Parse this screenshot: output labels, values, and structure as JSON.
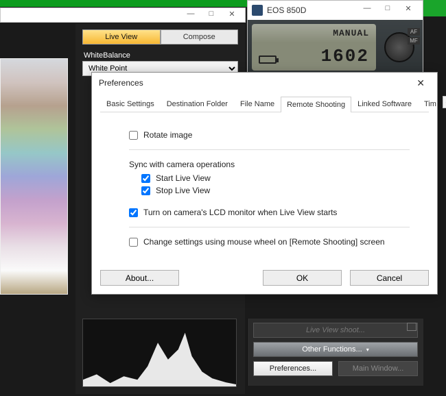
{
  "mainwin": {
    "controls": {
      "min": "—",
      "max": "□",
      "close": "✕"
    }
  },
  "rightstrip": {
    "tab_live": "Live View",
    "tab_compose": "Compose",
    "wb_label": "WhiteBalance",
    "wb_value": "White Point"
  },
  "eos": {
    "title": "EOS 850D",
    "mode": "MANUAL",
    "shots": "1602",
    "af": "AF",
    "mf": "MF"
  },
  "rpanel": {
    "liveview": "Live View shoot...",
    "other": "Other Functions...",
    "prefs": "Preferences...",
    "mainwin": "Main Window..."
  },
  "dlg": {
    "title": "Preferences",
    "tabs": {
      "basic": "Basic Settings",
      "dest": "Destination Folder",
      "file": "File Name",
      "remote": "Remote Shooting",
      "linked": "Linked Software",
      "tim": "Tim"
    },
    "rotate": "Rotate image",
    "sync_h": "Sync with camera operations",
    "start_lv": "Start Live View",
    "stop_lv": "Stop Live View",
    "lcd": "Turn on camera's LCD monitor when Live View starts",
    "wheel": "Change settings using mouse wheel on [Remote Shooting] screen",
    "about": "About...",
    "ok": "OK",
    "cancel": "Cancel"
  }
}
